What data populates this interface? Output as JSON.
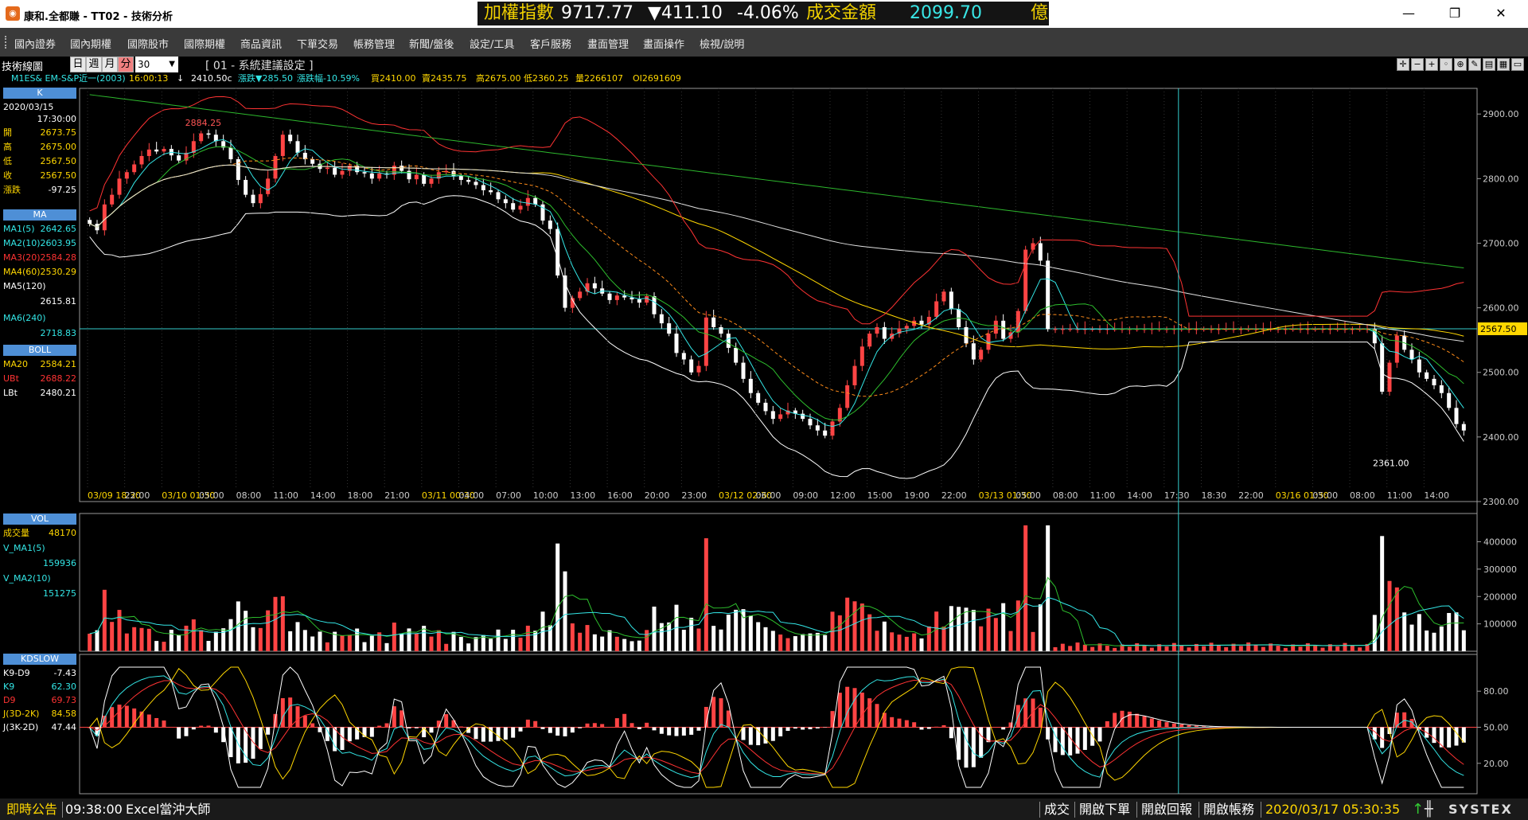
{
  "window": {
    "title": "康和.全都賺 - TT02 - 技術分析",
    "icon_name": "app-logo-icon",
    "controls": [
      "minimize-icon",
      "restore-icon",
      "close-icon"
    ]
  },
  "ticker": {
    "label": "加權指數",
    "value": "9717.77",
    "change": "▼411.10",
    "pct": "-4.06%",
    "vol_label": "成交金額",
    "vol_value": "2099.70",
    "unit": "億",
    "colors": {
      "label": "#f0d000",
      "value": "#ffffff",
      "down": "#ffffff",
      "vol_value": "#39e6e6"
    }
  },
  "menu": [
    "國內證券",
    "國內期權",
    "國際股市",
    "國際期權",
    "商品資訊",
    "下單交易",
    "帳務管理",
    "新聞/盤後",
    "設定/工具",
    "客戶服務",
    "畫面管理",
    "畫面操作",
    "檢視/說明"
  ],
  "toolbar": {
    "label": "技術線圖",
    "periods": [
      "日",
      "週",
      "月",
      "分"
    ],
    "active_period": "分",
    "interval": "30",
    "settings": "[ 01 - 系統建議設定 ]"
  },
  "quote": {
    "symbol": "M1ES&  EM-S&P近一(2003)",
    "time": "16:00:13",
    "arrow": "↓",
    "price": "2410.50c",
    "chg": "漲跌▼285.50",
    "chgpct": "漲跌幅-10.59%",
    "buy": "買2410.00",
    "sell": "賣2435.75",
    "high": "高2675.00",
    "low": "低2360.25",
    "vol": "量2266107",
    "oi": "OI2691609"
  },
  "left_panel": {
    "k_title": "K",
    "date": "2020/03/15",
    "time": "17:30:00",
    "ohlc": [
      {
        "label": "開",
        "value": "2673.75"
      },
      {
        "label": "高",
        "value": "2675.00"
      },
      {
        "label": "低",
        "value": "2567.50"
      },
      {
        "label": "收",
        "value": "2567.50"
      },
      {
        "label": "漲跌",
        "value": "-97.25"
      }
    ],
    "ma_title": "MA",
    "ma": [
      {
        "label": "MA1(5)",
        "value": "2642.65",
        "color": "#33e6e6"
      },
      {
        "label": "MA2(10)",
        "value": "2603.95",
        "color": "#33e6e6"
      },
      {
        "label": "MA3(20)",
        "value": "2584.28",
        "color": "#ff3333"
      },
      {
        "label": "MA4(60)",
        "value": "2530.29",
        "color": "#ffd700"
      },
      {
        "label": "MA5(120)",
        "value": "2615.81",
        "color": "#ffffff"
      },
      {
        "label": "MA6(240)",
        "value": "2718.83",
        "color": "#33e6e6"
      }
    ],
    "boll_title": "BOLL",
    "boll": [
      {
        "label": "MA20",
        "value": "2584.21",
        "color": "#ffd700"
      },
      {
        "label": "UBt",
        "value": "2688.22",
        "color": "#ff3333"
      },
      {
        "label": "LBt",
        "value": "2480.21",
        "color": "#ffffff"
      }
    ],
    "vol_title": "VOL",
    "vol": [
      {
        "label": "成交量",
        "value": "48170",
        "color": "#ffd700"
      },
      {
        "label": "V_MA1(5)",
        "value": "159936",
        "color": "#33e6e6"
      },
      {
        "label": "V_MA2(10)",
        "value": "151275",
        "color": "#33e6e6"
      }
    ],
    "kd_title": "KDSLOW",
    "kd": [
      {
        "label": "K9-D9",
        "value": "-7.43",
        "color": "#ffffff"
      },
      {
        "label": "K9",
        "value": "62.30",
        "color": "#33e6e6"
      },
      {
        "label": "D9",
        "value": "69.73",
        "color": "#ff3333"
      },
      {
        "label": "J(3D-2K)",
        "value": "84.58",
        "color": "#ffd700"
      },
      {
        "label": "J(3K-2D)",
        "value": "47.44",
        "color": "#ffffff"
      }
    ]
  },
  "chart_data": {
    "type": "candlestick",
    "price_axis": {
      "ticks": [
        "2900.00",
        "2800.00",
        "2700.00",
        "2600.00",
        "2500.00",
        "2400.00",
        "2300.00"
      ],
      "range": [
        2300,
        2920
      ],
      "current": "2567.50"
    },
    "annotations": {
      "high_label": "2884.25",
      "low_label": "2361.00"
    },
    "time_labels": [
      "03/09 18:30",
      "22:00",
      "03/10 01:30",
      "05:00",
      "08:00",
      "11:00",
      "14:00",
      "18:00",
      "21:00",
      "03/11 00:30",
      "04:00",
      "07:00",
      "10:00",
      "13:00",
      "16:00",
      "20:00",
      "23:00",
      "03/12 02:30",
      "06:00",
      "09:00",
      "12:00",
      "15:00",
      "19:00",
      "22:00",
      "03/13 01:30",
      "05:00",
      "08:00",
      "11:00",
      "14:00",
      "17:30",
      "18:30",
      "22:00",
      "03/16 01:30",
      "05:00",
      "08:00",
      "11:00",
      "14:00"
    ],
    "closes": [
      2730,
      2720,
      2760,
      2775,
      2800,
      2810,
      2822,
      2835,
      2845,
      2842,
      2846,
      2836,
      2828,
      2840,
      2858,
      2870,
      2868,
      2858,
      2848,
      2830,
      2798,
      2775,
      2762,
      2776,
      2800,
      2835,
      2868,
      2858,
      2840,
      2830,
      2823,
      2815,
      2817,
      2806,
      2812,
      2820,
      2810,
      2808,
      2800,
      2808,
      2806,
      2820,
      2812,
      2799,
      2806,
      2792,
      2800,
      2810,
      2812,
      2804,
      2798,
      2795,
      2790,
      2782,
      2779,
      2768,
      2762,
      2752,
      2758,
      2770,
      2760,
      2735,
      2722,
      2650,
      2600,
      2615,
      2625,
      2638,
      2630,
      2622,
      2612,
      2619,
      2616,
      2613,
      2608,
      2618,
      2590,
      2576,
      2560,
      2530,
      2520,
      2500,
      2510,
      2585,
      2570,
      2560,
      2538,
      2515,
      2490,
      2468,
      2453,
      2440,
      2428,
      2435,
      2441,
      2436,
      2428,
      2418,
      2410,
      2402,
      2424,
      2445,
      2480,
      2510,
      2540,
      2560,
      2570,
      2552,
      2560,
      2568,
      2572,
      2580,
      2574,
      2586,
      2610,
      2625,
      2598,
      2570,
      2545,
      2520,
      2535,
      2560,
      2580,
      2552,
      2562,
      2595,
      2690,
      2700,
      2673,
      2567,
      2567,
      2567,
      2567,
      2567,
      2567,
      2567,
      2567,
      2567,
      2567,
      2567,
      2567,
      2567,
      2567,
      2567,
      2567,
      2567,
      2567,
      2567,
      2567,
      2567,
      2567,
      2567,
      2567,
      2567,
      2567,
      2567,
      2567,
      2567,
      2567,
      2567,
      2567,
      2567,
      2567,
      2567,
      2567,
      2567,
      2567,
      2567,
      2567,
      2567,
      2567,
      2567,
      2567,
      2545,
      2470,
      2515,
      2557,
      2535,
      2520,
      2500,
      2490,
      2480,
      2468,
      2445,
      2420,
      2410
    ],
    "volume_axis": {
      "ticks": [
        "400000",
        "300000",
        "200000",
        "100000"
      ],
      "range": [
        0,
        480000
      ]
    },
    "kd_axis": {
      "ticks": [
        "80.00",
        "50.00",
        "20.00"
      ],
      "range": [
        0,
        100
      ]
    }
  },
  "status": {
    "news_label": "即時公告",
    "news_time": "09:38:00",
    "news_text": "Excel當沖大師",
    "links": [
      "成交",
      "開啟下單",
      "開啟回報",
      "開啟帳務"
    ],
    "datetime": "2020/03/17 05:30:35",
    "brand": "SYSTEX"
  }
}
